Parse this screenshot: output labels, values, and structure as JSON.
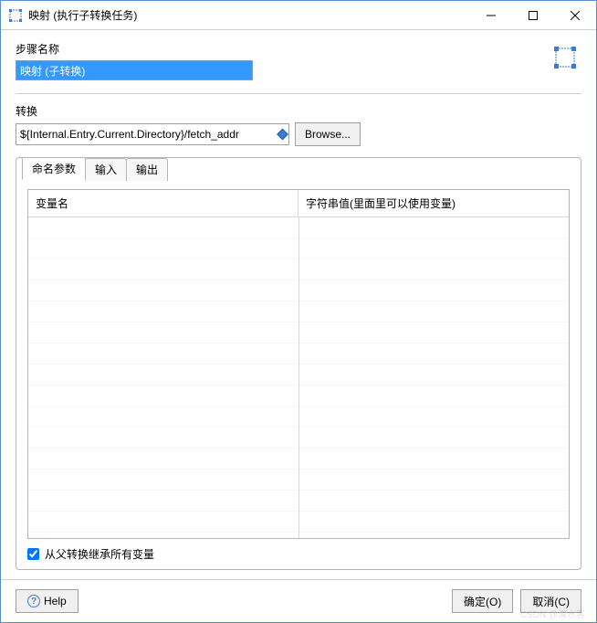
{
  "window": {
    "title": "映射 (执行子转换任务)"
  },
  "step": {
    "label": "步骤名称",
    "name": "映射 (子转换)"
  },
  "transform": {
    "label": "转换",
    "value": "${Internal.Entry.Current.Directory}/fetch_addr",
    "browse_label": "Browse..."
  },
  "tabs": {
    "items": [
      {
        "label": "命名参数",
        "active": true
      },
      {
        "label": "输入",
        "active": false
      },
      {
        "label": "输出",
        "active": false
      }
    ]
  },
  "grid": {
    "columns": [
      "变量名",
      "字符串值(里面里可以使用变量)"
    ],
    "rows": []
  },
  "inherit": {
    "label": "从父转换继承所有变量",
    "checked": true
  },
  "footer": {
    "help_label": "Help",
    "ok_label": "确定(O)",
    "cancel_label": "取消(C)"
  },
  "watermark": "CSDN @清水客"
}
